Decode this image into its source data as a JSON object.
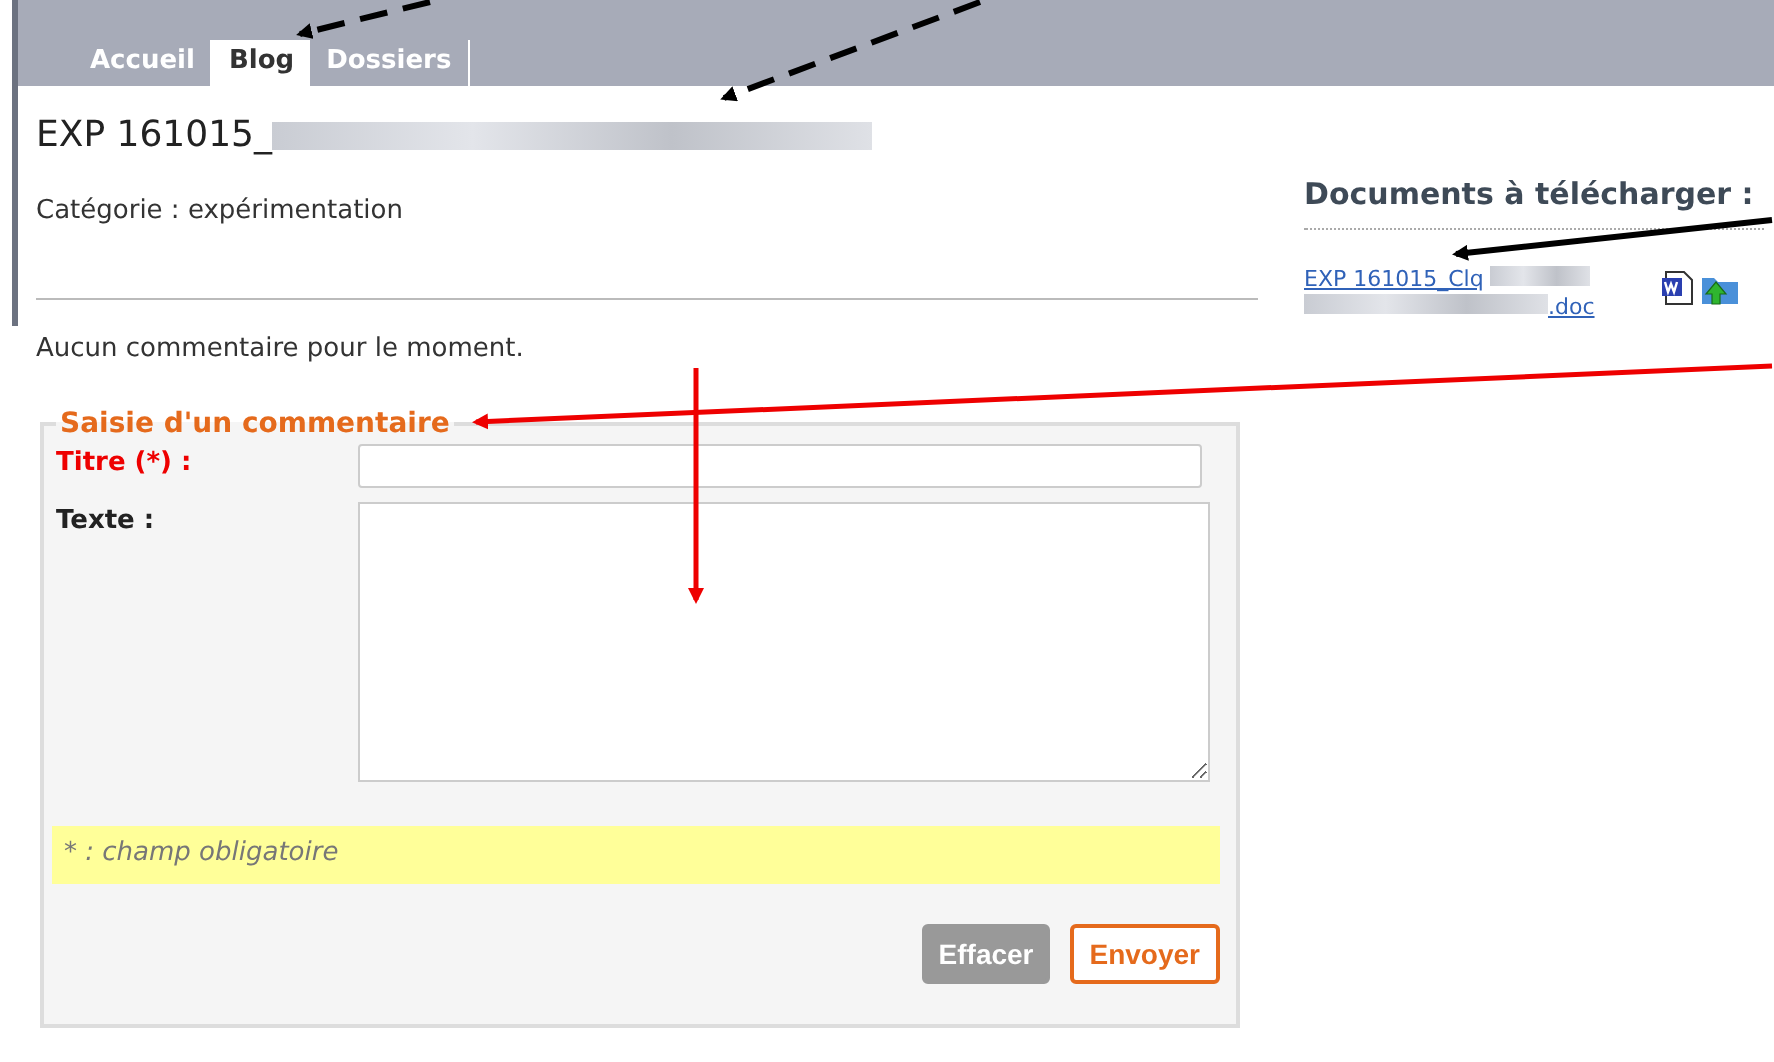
{
  "tabs": [
    {
      "label": "Accueil",
      "selected": false
    },
    {
      "label": "Blog",
      "selected": true
    },
    {
      "label": "Dossiers",
      "selected": false
    }
  ],
  "post": {
    "title": "EXP 161015_",
    "category": "Catégorie : expérimentation",
    "comments_note": "Aucun commentaire pour le moment."
  },
  "documents": {
    "heading": "Documents à télécharger :",
    "link_start": "EXP 161015_Clq",
    "link_end": ".doc"
  },
  "form": {
    "legend": "Saisie d'un commentaire",
    "fields": [
      {
        "label": "Titre (*) :",
        "kind": "input",
        "required": true
      },
      {
        "label": "Texte :",
        "kind": "textarea",
        "required": false
      }
    ],
    "note": "* : champ obligatoire",
    "buttons": [
      {
        "label": "Effacer",
        "kind": "reset"
      },
      {
        "label": "Envoyer",
        "kind": "submit"
      }
    ]
  }
}
